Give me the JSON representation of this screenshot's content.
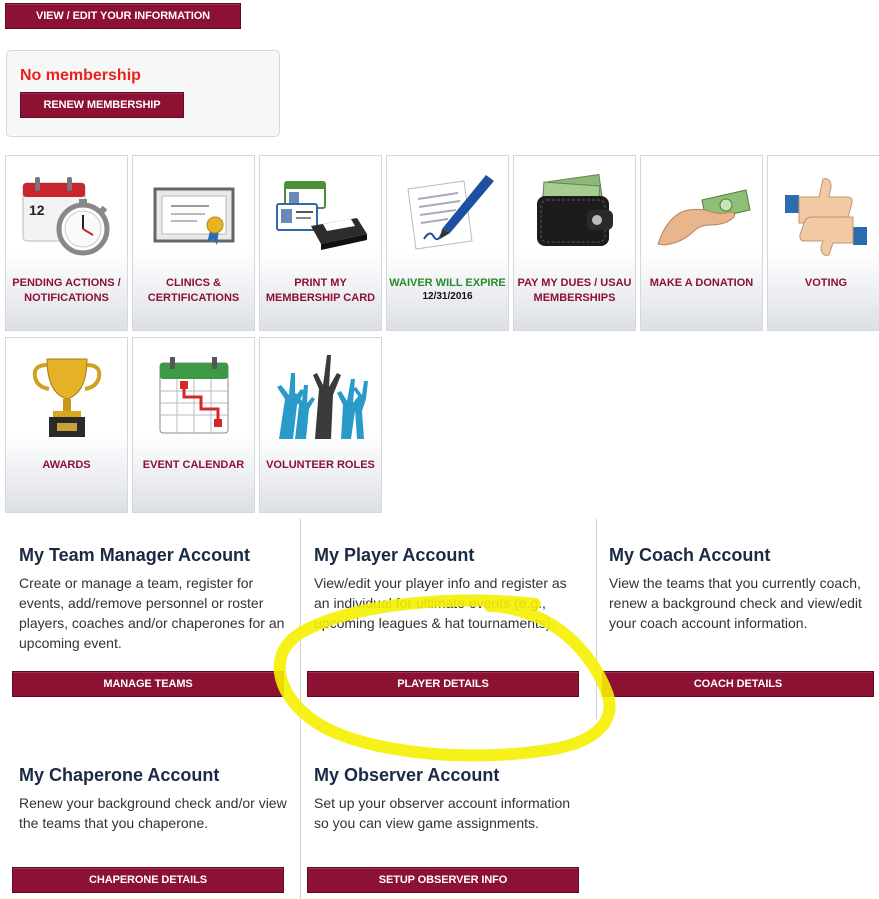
{
  "header": {
    "view_edit_label": "VIEW / EDIT YOUR INFORMATION"
  },
  "membership": {
    "status": "No membership",
    "renew_label": "RENEW MEMBERSHIP"
  },
  "tiles": [
    {
      "label": "PENDING ACTIONS / NOTIFICATIONS",
      "icon": "calendar-clock-icon"
    },
    {
      "label": "CLINICS & CERTIFICATIONS",
      "icon": "certificate-icon"
    },
    {
      "label": "PRINT MY MEMBERSHIP CARD",
      "icon": "printer-card-icon"
    },
    {
      "label": "WAIVER WILL EXPIRE",
      "sub": "12/31/2016",
      "icon": "waiver-pen-icon"
    },
    {
      "label": "PAY MY DUES / USAU MEMBERSHIPS",
      "icon": "wallet-icon"
    },
    {
      "label": "MAKE A DONATION",
      "icon": "donation-hand-icon"
    },
    {
      "label": "VOTING",
      "icon": "thumbs-up-down-icon"
    },
    {
      "label": "AWARDS",
      "icon": "trophy-icon"
    },
    {
      "label": "EVENT CALENDAR",
      "icon": "event-calendar-icon"
    },
    {
      "label": "VOLUNTEER ROLES",
      "icon": "raised-hands-icon"
    }
  ],
  "accounts": [
    {
      "title": "My Team Manager Account",
      "description": "Create or manage a team, register for events, add/remove personnel or roster players, coaches and/or chaperones for an upcoming event.",
      "button": "MANAGE TEAMS"
    },
    {
      "title": "My Player Account",
      "description": "View/edit your player info and register as an individual for ultimate events (e.g., upcoming leagues & hat tournaments).",
      "button": "PLAYER DETAILS"
    },
    {
      "title": "My Coach Account",
      "description": "View the teams that you currently coach, renew a background check and view/edit your coach account information.",
      "button": "COACH DETAILS"
    },
    {
      "title": "My Chaperone Account",
      "description": "Renew your background check and/or view the teams that you chaperone.",
      "button": "CHAPERONE DETAILS"
    },
    {
      "title": "My Observer Account",
      "description": "Set up your observer account information so you can view game assignments.",
      "button": "SETUP OBSERVER INFO"
    }
  ],
  "colors": {
    "brand": "#8c1132",
    "status_error": "#e8221c",
    "waiver_green": "#2a8a2a",
    "highlight": "#f5f000"
  }
}
